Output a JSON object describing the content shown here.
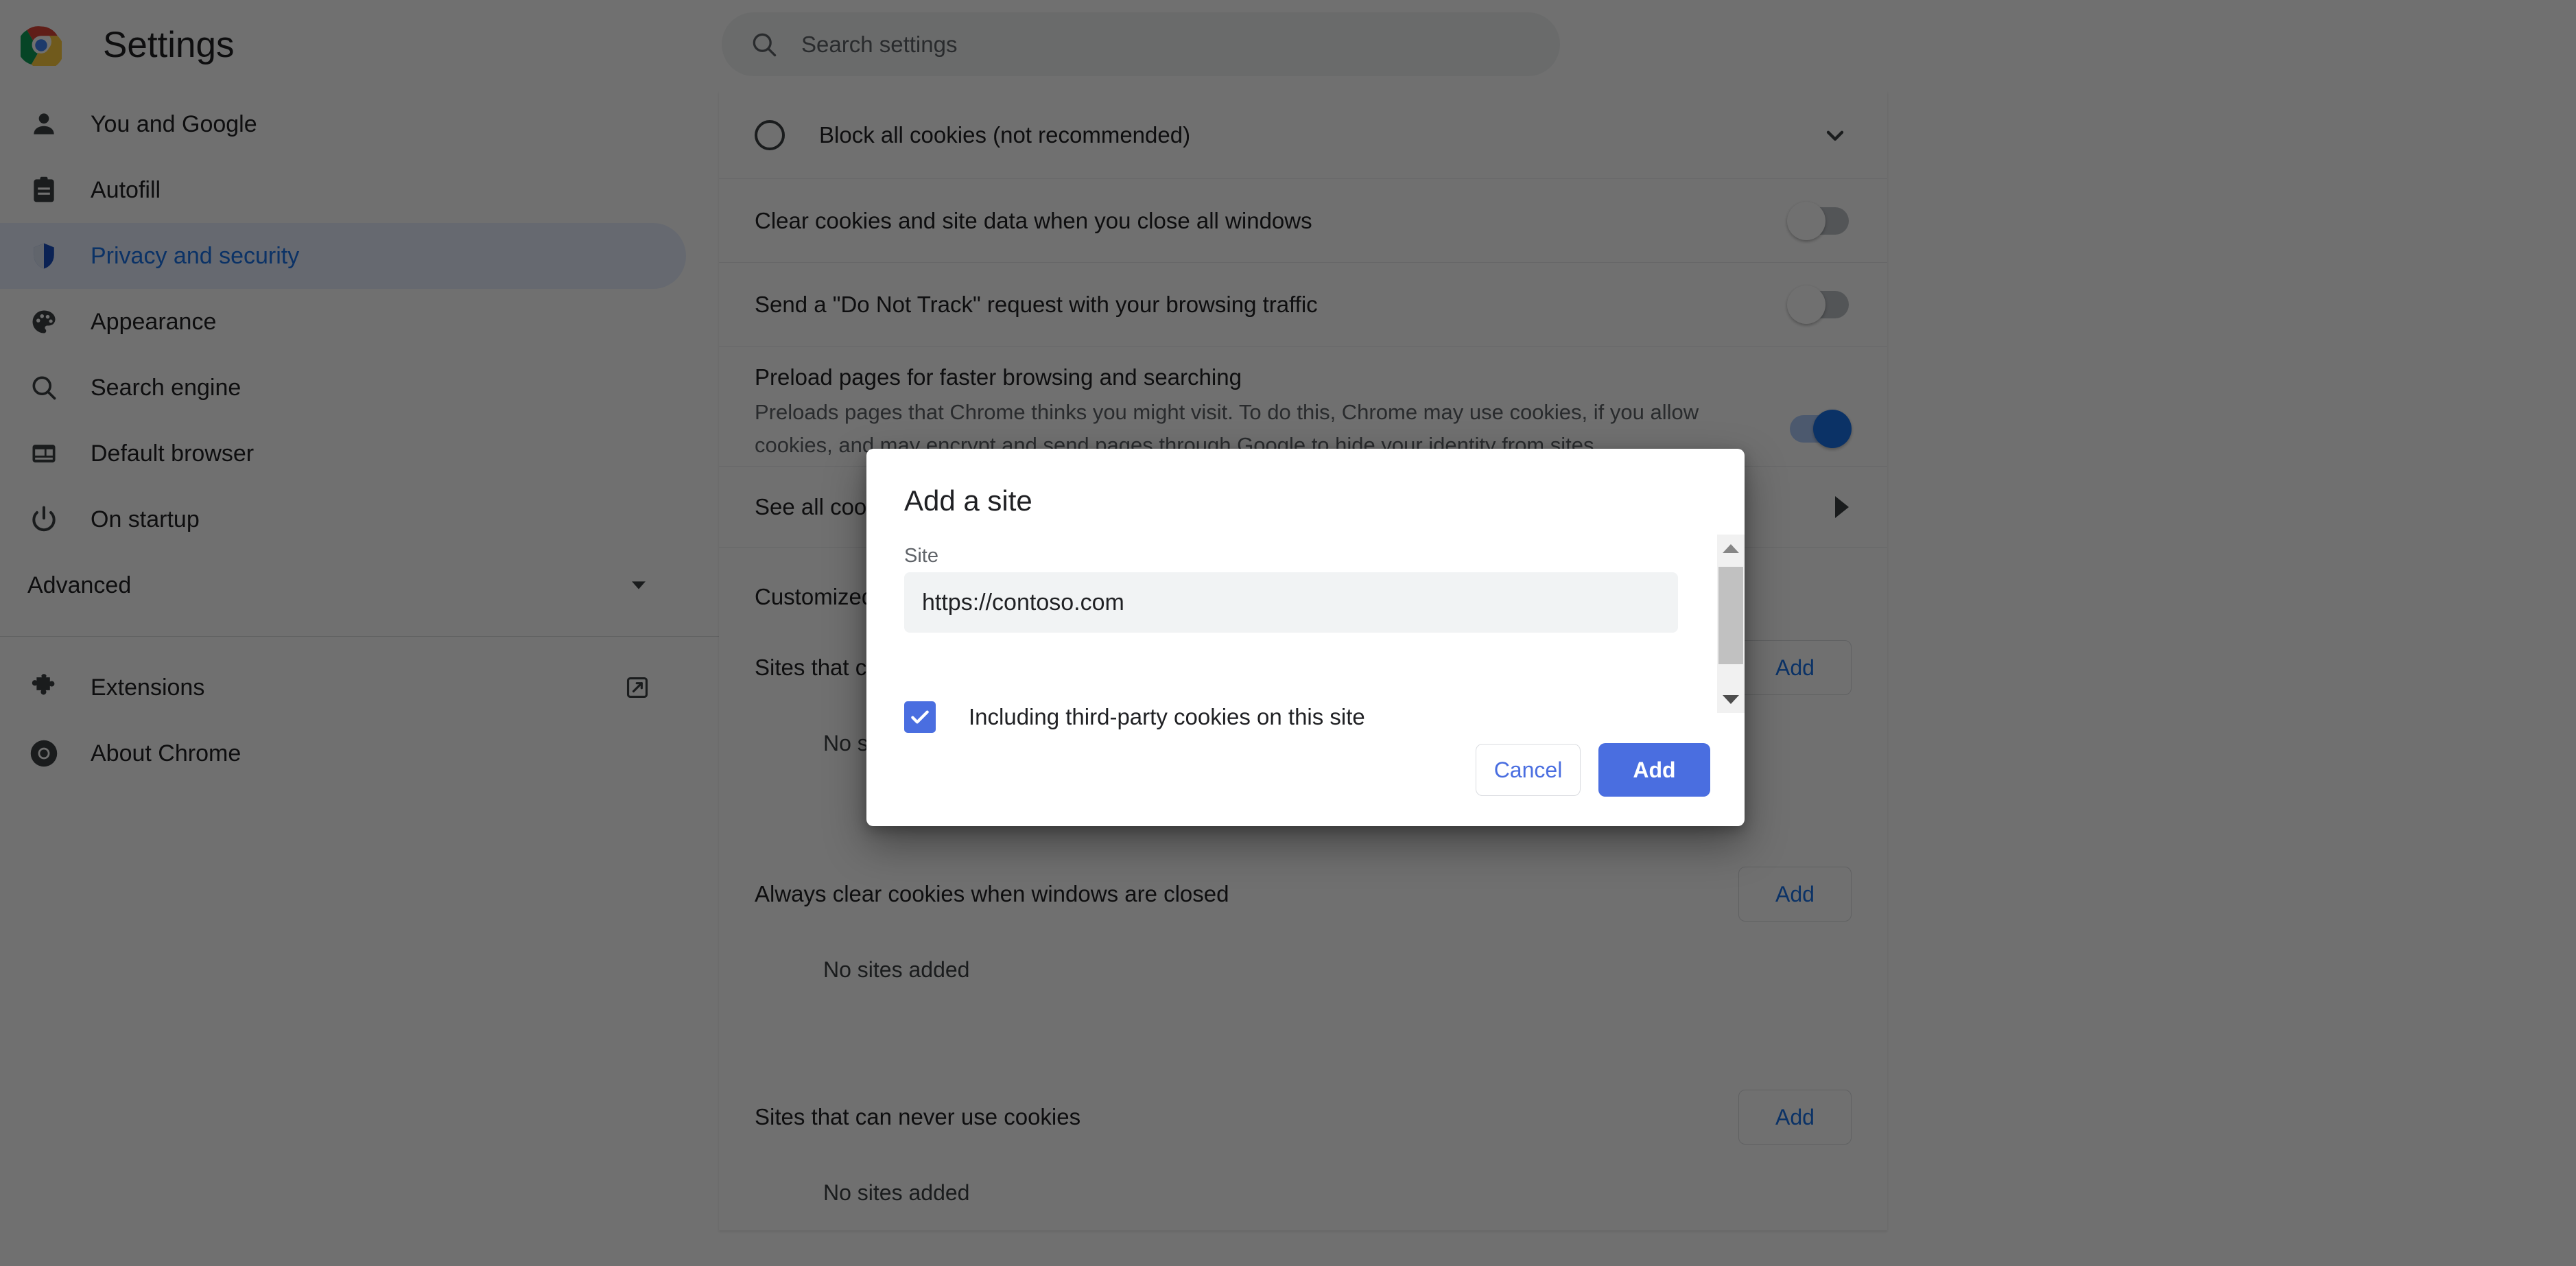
{
  "header": {
    "title": "Settings",
    "logo_icon": "chrome-logo",
    "search": {
      "icon": "search-icon",
      "placeholder": "Search settings",
      "value": ""
    }
  },
  "sidebar": {
    "items": [
      {
        "label": "You and Google",
        "icon": "person-icon",
        "active": false
      },
      {
        "label": "Autofill",
        "icon": "clipboard-icon",
        "active": false
      },
      {
        "label": "Privacy and security",
        "icon": "shield-icon",
        "active": true
      },
      {
        "label": "Appearance",
        "icon": "palette-icon",
        "active": false
      },
      {
        "label": "Search engine",
        "icon": "search-icon",
        "active": false
      },
      {
        "label": "Default browser",
        "icon": "browser-window-icon",
        "active": false
      },
      {
        "label": "On startup",
        "icon": "power-icon",
        "active": false
      }
    ],
    "advanced": {
      "label": "Advanced",
      "icon": "chevron-down-icon"
    },
    "footer_items": [
      {
        "label": "Extensions",
        "icon": "puzzle-icon",
        "trailing_icon": "external-link-icon"
      },
      {
        "label": "About Chrome",
        "icon": "chrome-logo-icon"
      }
    ]
  },
  "main": {
    "rows": [
      {
        "title": "Block all cookies (not recommended)",
        "control": "radio",
        "radio_selected": false,
        "trailing_icon": "chevron-down-icon"
      },
      {
        "title": "Clear cookies and site data when you close all windows",
        "control": "toggle",
        "toggle_on": false
      },
      {
        "title": "Send a \"Do Not Track\" request with your browsing traffic",
        "control": "toggle",
        "toggle_on": false
      },
      {
        "title": "Preload pages for faster browsing and searching",
        "subtitle": "Preloads pages that Chrome thinks you might visit. To do this, Chrome may use cookies, if you allow cookies, and may encrypt and send pages through Google to hide your identity from sites.",
        "control": "toggle",
        "toggle_on": true
      },
      {
        "title": "See all cookies and site data",
        "control": "arrow",
        "trailing_icon": "triangle-right-icon"
      }
    ],
    "customized_heading": "Customized behaviors",
    "site_sections": [
      {
        "title": "Sites that can always use cookies",
        "add_label": "Add",
        "empty_text": "No sites added"
      },
      {
        "title": "Always clear cookies when windows are closed",
        "add_label": "Add",
        "empty_text": "No sites added"
      },
      {
        "title": "Sites that can never use cookies",
        "add_label": "Add",
        "empty_text": "No sites added"
      }
    ]
  },
  "dialog": {
    "title": "Add a site",
    "field_label": "Site",
    "site_value": "https://contoso.com",
    "site_placeholder": "",
    "checkbox_label": "Including third-party cookies on this site",
    "checkbox_checked": true,
    "cancel_label": "Cancel",
    "add_label": "Add",
    "scrollbar": {
      "up_icon": "triangle-up-icon",
      "down_icon": "triangle-down-icon"
    }
  },
  "colors": {
    "accent_blue": "#1a73e8",
    "dialog_button_blue": "#4a6ee0",
    "active_nav_bg": "#e8f0fe",
    "input_bg": "#f1f3f4",
    "scrim": "rgba(0,0,0,0.56)"
  }
}
